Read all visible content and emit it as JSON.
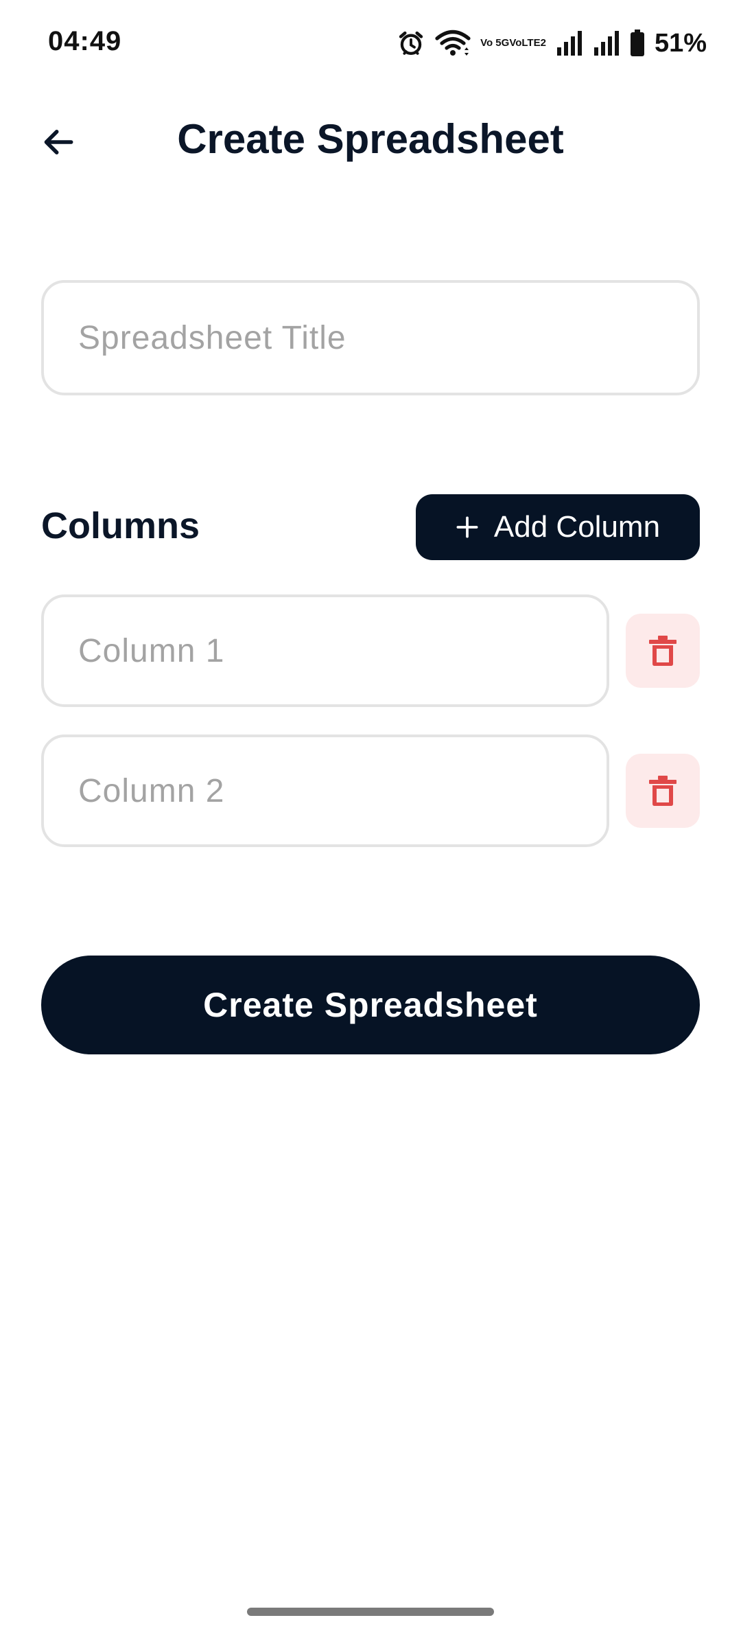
{
  "status_bar": {
    "time": "04:49",
    "network_label_top": "Vo 5G",
    "network_label_bottom": "VoLTE2",
    "battery_percent": "51%",
    "icons": [
      "alarm-icon",
      "wifi-icon",
      "signal-icon",
      "signal-icon",
      "battery-icon"
    ]
  },
  "header": {
    "title": "Create Spreadsheet",
    "back_icon": "arrow-left-icon"
  },
  "form": {
    "title_placeholder": "Spreadsheet Title",
    "title_value": ""
  },
  "columns": {
    "label": "Columns",
    "add_button_label": "Add Column",
    "add_icon": "plus-icon",
    "items": [
      {
        "placeholder": "Column 1",
        "value": "",
        "delete_icon": "trash-icon"
      },
      {
        "placeholder": "Column 2",
        "value": "",
        "delete_icon": "trash-icon"
      }
    ]
  },
  "submit": {
    "label": "Create Spreadsheet"
  },
  "colors": {
    "primary_dark": "#061325",
    "text_dark": "#0b1628",
    "danger": "#e04848",
    "danger_bg": "#fdeaea",
    "input_border": "#e3e3e3",
    "placeholder": "#a3a3a3"
  }
}
